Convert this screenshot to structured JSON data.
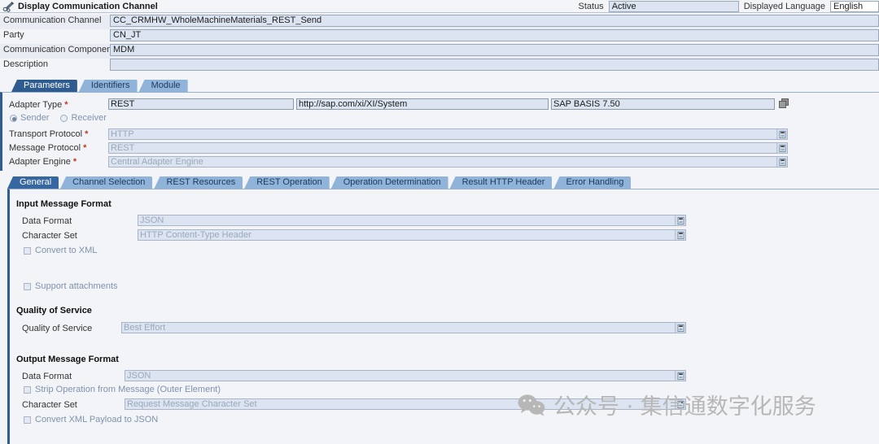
{
  "window": {
    "title": "Display Communication Channel",
    "title_icon": "display-pen-icon"
  },
  "header": {
    "status_label": "Status",
    "status_value": "Active",
    "language_label": "Displayed Language",
    "language_value": "English",
    "fields": [
      {
        "label": "Communication Channel",
        "value": "CC_CRMHW_WholeMachineMaterials_REST_Send"
      },
      {
        "label": "Party",
        "value": "CN_JT"
      },
      {
        "label": "Communication Component",
        "value": "MDM"
      },
      {
        "label": "Description",
        "value": ""
      }
    ]
  },
  "main_tabs": [
    {
      "label": "Parameters",
      "selected": true
    },
    {
      "label": "Identifiers",
      "selected": false
    },
    {
      "label": "Module",
      "selected": false
    }
  ],
  "adapter": {
    "type_label": "Adapter Type",
    "type_value": "REST",
    "namespace_value": "http://sap.com/xi/XI/System",
    "swcv_value": "SAP BASIS 7.50",
    "copy_icon": "copy-icon",
    "direction": {
      "sender_label": "Sender",
      "receiver_label": "Receiver",
      "selected": "Sender"
    },
    "rows": [
      {
        "label": "Transport Protocol",
        "value": "HTTP",
        "required": true
      },
      {
        "label": "Message Protocol",
        "value": "REST",
        "required": true
      },
      {
        "label": "Adapter Engine",
        "value": "Central Adapter Engine",
        "required": true
      }
    ]
  },
  "sub_tabs": [
    {
      "label": "General",
      "selected": true
    },
    {
      "label": "Channel Selection",
      "selected": false
    },
    {
      "label": "REST Resources",
      "selected": false
    },
    {
      "label": "REST Operation",
      "selected": false
    },
    {
      "label": "Operation Determination",
      "selected": false
    },
    {
      "label": "Result HTTP Header",
      "selected": false
    },
    {
      "label": "Error Handling",
      "selected": false
    }
  ],
  "general": {
    "input_section": {
      "title": "Input Message Format",
      "data_format_label": "Data Format",
      "data_format_value": "JSON",
      "charset_label": "Character Set",
      "charset_value": "HTTP Content-Type Header",
      "convert_to_xml_label": "Convert to XML",
      "convert_to_xml_checked": false,
      "support_attachments_label": "Support attachments",
      "support_attachments_checked": false
    },
    "qos_section": {
      "title": "Quality of Service",
      "qos_label": "Quality of Service",
      "qos_value": "Best Effort"
    },
    "output_section": {
      "title": "Output Message Format",
      "data_format_label": "Data Format",
      "data_format_value": "JSON",
      "strip_operation_label": "Strip Operation from Message (Outer Element)",
      "strip_operation_checked": false,
      "charset_label": "Character Set",
      "charset_value": "Request Message Character Set",
      "convert_xml_to_json_label": "Convert XML Payload to JSON",
      "convert_xml_to_json_checked": false
    }
  },
  "watermark": {
    "text": "公众号 · 集信通数字化服务",
    "logo_icon": "wechat-icon"
  },
  "colors": {
    "tab_selected": "#2f5c8f",
    "tab_normal": "#8fb3d9",
    "field_bg": "#dbe4f0",
    "page_bg": "#f2f4f7",
    "required_marker": "#c0392b"
  }
}
